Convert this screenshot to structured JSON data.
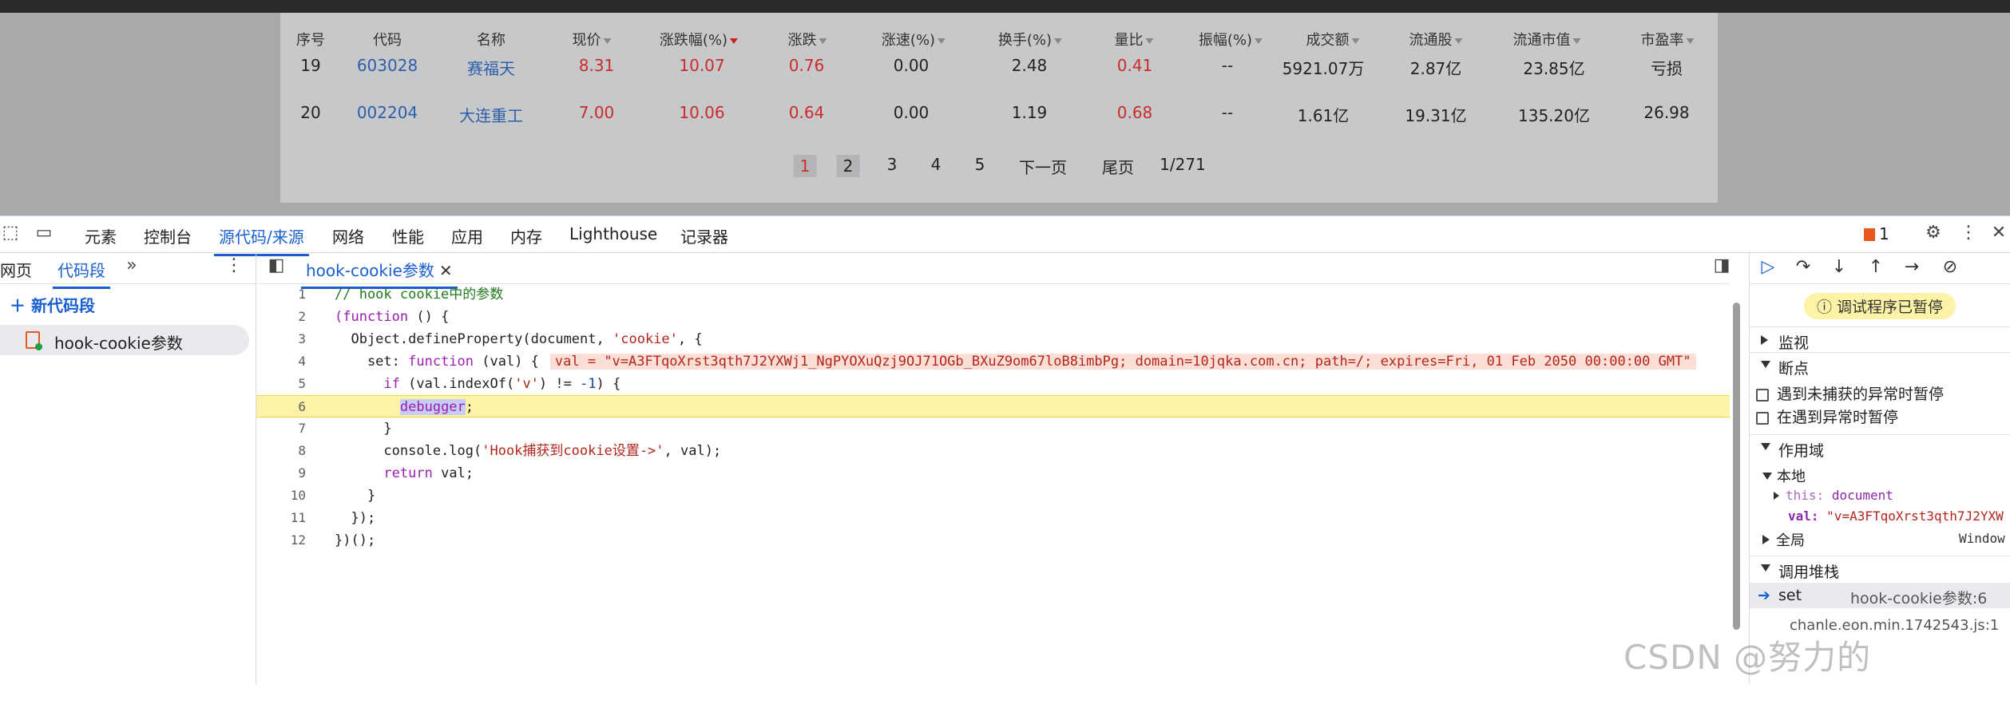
{
  "stock_table": {
    "headers": [
      "序号",
      "代码",
      "名称",
      "现价",
      "涨跌幅(%)",
      "涨跌",
      "涨速(%)",
      "换手(%)",
      "量比",
      "振幅(%)",
      "成交额",
      "流通股",
      "流通市值",
      "市盈率"
    ],
    "rows": [
      [
        "19",
        "603028",
        "赛福天",
        "8.31",
        "10.07",
        "0.76",
        "0.00",
        "2.48",
        "0.41",
        "--",
        "5921.07万",
        "2.87亿",
        "23.85亿",
        "亏损"
      ],
      [
        "20",
        "002204",
        "大连重工",
        "7.00",
        "10.06",
        "0.64",
        "0.00",
        "1.19",
        "0.68",
        "--",
        "1.61亿",
        "19.31亿",
        "135.20亿",
        "26.98"
      ]
    ],
    "pagination": {
      "pages": [
        "1",
        "2",
        "3",
        "4",
        "5"
      ],
      "next": "下一页",
      "last": "尾页",
      "total": "1/271"
    }
  },
  "devtools": {
    "panels": [
      "元素",
      "控制台",
      "源代码/来源",
      "网络",
      "性能",
      "应用",
      "内存",
      "Lighthouse",
      "记录器"
    ],
    "issues_count": "1",
    "navigator": {
      "tabs": [
        "网页",
        "代码段"
      ],
      "new_snippet": "新代码段",
      "snippet_name": "hook-cookie参数"
    },
    "editor": {
      "file_tab": "hook-cookie参数",
      "code": {
        "l1": "// hook cookie中的参数",
        "l2_kw": "(function",
        "l2_rest": " () {",
        "l3_a": "  Object.defineProperty(document, ",
        "l3_str": "'cookie'",
        "l3_b": ", {",
        "l4_a": "    set: ",
        "l4_kw": "function",
        "l4_b": " (val) {",
        "l4_inline": "val = \"v=A3FTqoXrst3qth7J2YXWj1_NgPYOXuQzj9OJ71OGb_BXuZ9om67loB8imbPg; domain=10jqka.com.cn; path=/; expires=Fri, 01 Feb 2050 00:00:00 GMT\"",
        "l5_a": "      ",
        "l5_kw": "if",
        "l5_b": " (val.indexOf(",
        "l5_str": "'v'",
        "l5_c": ") != ",
        "l5_num": "-1",
        "l5_d": ") {",
        "l6_pad": "        ",
        "l6_kw": "debugger",
        "l6_end": ";",
        "l7": "      }",
        "l8_a": "      console.log(",
        "l8_str": "'Hook捕获到cookie设置->'",
        "l8_b": ", val);",
        "l9_a": "      ",
        "l9_kw": "return",
        "l9_b": " val;",
        "l10": "    }",
        "l11": "  });",
        "l12": "})();"
      },
      "line_numbers": [
        "1",
        "2",
        "3",
        "4",
        "5",
        "6",
        "7",
        "8",
        "9",
        "10",
        "11",
        "12"
      ]
    },
    "debugger": {
      "paused_text": "调试程序已暂停",
      "sections": {
        "watch": "监视",
        "breakpoints": "断点",
        "scope": "作用域",
        "call_stack": "调用堆栈"
      },
      "breakpoint_options": [
        "遇到未捕获的异常时暂停",
        "在遇到异常时暂停"
      ],
      "scope": {
        "local": "本地",
        "this_key": "this:",
        "this_val": "document",
        "val_key": "val:",
        "val_val": "\"v=A3FTqoXrst3qth7J2YXW",
        "global": "全局",
        "global_val": "Window"
      },
      "call_stack": [
        {
          "fn": "set",
          "loc": "hook-cookie参数:6"
        },
        {
          "fn": "",
          "loc": "chanle.eon.min.1742543.js:1"
        }
      ]
    }
  },
  "watermark": "CSDN @努力的"
}
